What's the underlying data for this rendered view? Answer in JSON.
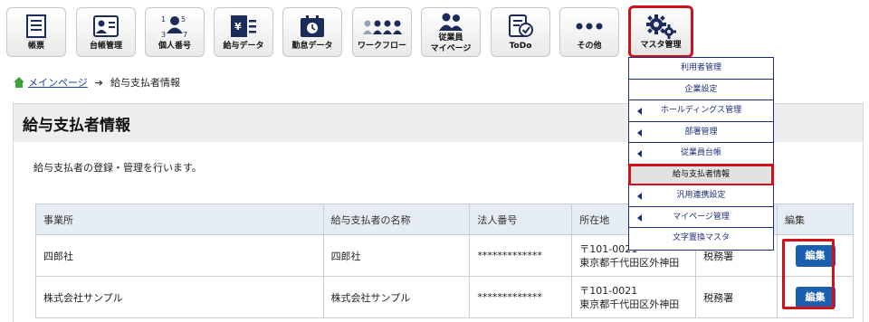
{
  "toolbar": {
    "buttons": [
      {
        "label": "帳票",
        "icon": "report-icon"
      },
      {
        "label": "台帳管理",
        "icon": "ledger-icon"
      },
      {
        "label": "個人番号",
        "icon": "personal-number-icon"
      },
      {
        "label": "給与データ",
        "icon": "salary-data-icon"
      },
      {
        "label": "勤怠データ",
        "icon": "attendance-icon"
      },
      {
        "label": "ワークフロー",
        "icon": "workflow-icon"
      },
      {
        "label": "従業員",
        "label2": "マイページ",
        "icon": "employee-mypage-icon"
      },
      {
        "label": "ToDo",
        "icon": "todo-icon"
      },
      {
        "label": "その他",
        "icon": "more-icon"
      },
      {
        "label": "マスタ管理",
        "icon": "gears-icon"
      }
    ],
    "active_index": 9,
    "accent": "#d0101a"
  },
  "breadcrumb": {
    "home": "メインページ",
    "current": "給与支払者情報"
  },
  "page": {
    "title": "給与支払者情報",
    "description": "給与支払者の登録・管理を行います。"
  },
  "table": {
    "headers": [
      "事業所",
      "給与支払者の名称",
      "法人番号",
      "所在地",
      "",
      "編集"
    ],
    "rows": [
      {
        "office": "四郎社",
        "name": "四郎社",
        "corp_no": "*************",
        "zip": "〒101-0021",
        "address": "東京都千代田区外神田",
        "tax_office": "税務署",
        "edit": "編集"
      },
      {
        "office": "株式会社サンプル",
        "name": "株式会社サンプル",
        "corp_no": "*************",
        "zip": "〒101-0021",
        "address": "東京都千代田区外神田",
        "tax_office": "税務署",
        "edit": "編集"
      }
    ]
  },
  "menu": {
    "items": [
      {
        "label": "利用者管理",
        "submenu": false
      },
      {
        "label": "企業設定",
        "submenu": false
      },
      {
        "label": "ホールディングス管理",
        "submenu": true
      },
      {
        "label": "部署管理",
        "submenu": true
      },
      {
        "label": "従業員台帳",
        "submenu": true
      },
      {
        "label": "給与支払者情報",
        "submenu": false
      },
      {
        "label": "汎用連携設定",
        "submenu": true
      },
      {
        "label": "マイページ管理",
        "submenu": true
      },
      {
        "label": "文字置換マスタ",
        "submenu": false
      }
    ],
    "selected_index": 5
  }
}
